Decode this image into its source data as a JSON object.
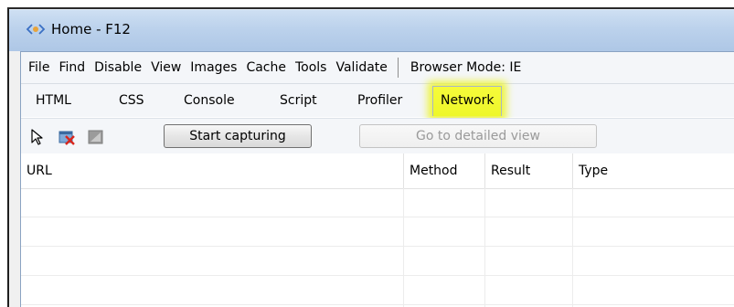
{
  "window": {
    "title": "Home - F12"
  },
  "menu": [
    "File",
    "Find",
    "Disable",
    "View",
    "Images",
    "Cache",
    "Tools",
    "Validate"
  ],
  "browser_mode": "Browser Mode: IE",
  "tabs": [
    "HTML",
    "CSS",
    "Console",
    "Script",
    "Profiler",
    "Network"
  ],
  "active_tab": "Network",
  "highlight_color": "#eef72a",
  "toolbar": {
    "icons": [
      "select-element-icon",
      "clear-entries-icon",
      "disabled-option-icon"
    ],
    "start_capture_label": "Start capturing",
    "detailed_view_label": "Go to detailed view"
  },
  "table": {
    "columns": [
      "URL",
      "Method",
      "Result",
      "Type"
    ],
    "rows": []
  }
}
